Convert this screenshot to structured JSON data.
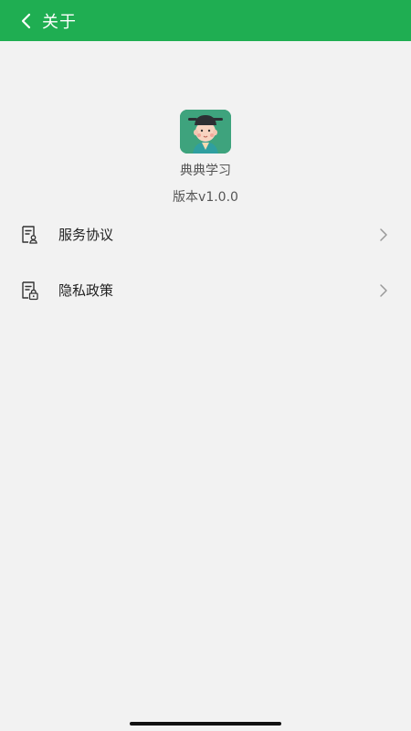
{
  "header": {
    "title": "关于",
    "background": "#1fae52"
  },
  "app": {
    "name": "典典学习",
    "version": "版本v1.0.0",
    "icon": "app-logo-icon"
  },
  "menu": {
    "items": [
      {
        "label": "服务协议",
        "icon": "document-user-icon"
      },
      {
        "label": "隐私政策",
        "icon": "document-lock-icon"
      }
    ]
  }
}
